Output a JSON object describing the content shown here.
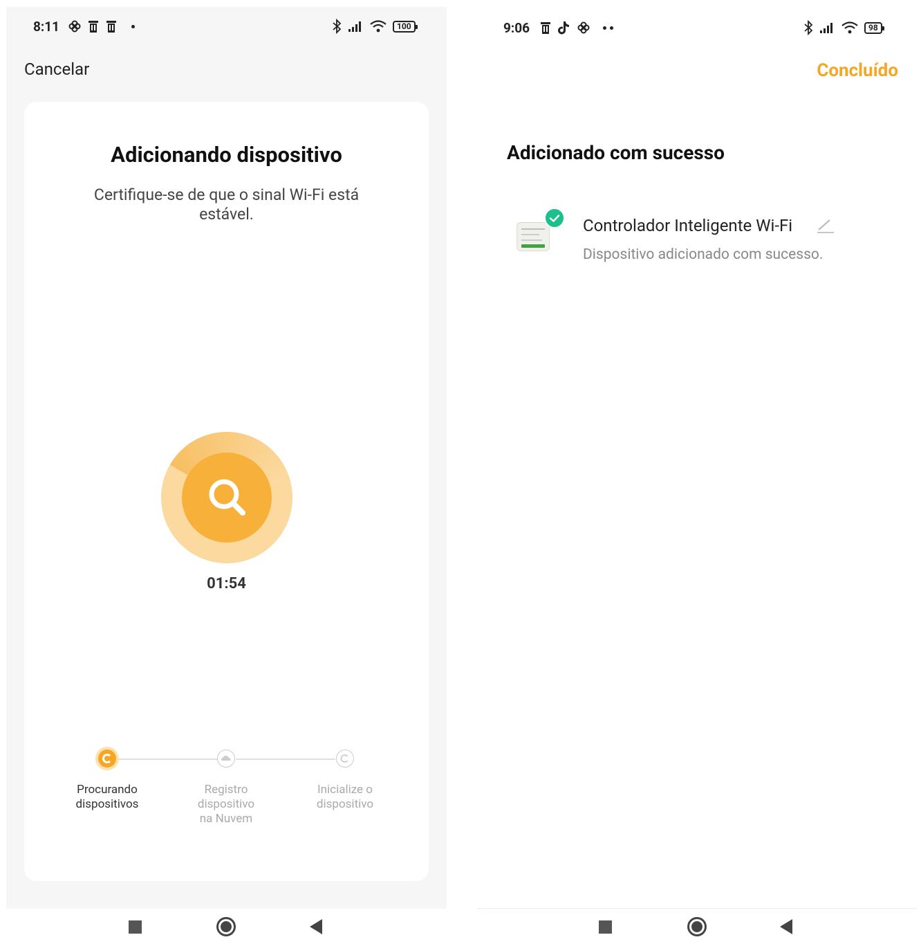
{
  "left": {
    "status": {
      "time": "8:11",
      "battery": "100"
    },
    "cancel_label": "Cancelar",
    "title": "Adicionando dispositivo",
    "subtitle": "Certifique-se de que o sinal Wi-Fi está estável.",
    "timer": "01:54",
    "steps": [
      {
        "label": "Procurando dispositivos",
        "active": true
      },
      {
        "label": "Registro dispositivo na Nuvem",
        "active": false
      },
      {
        "label": "Inicialize o dispositivo",
        "active": false
      }
    ]
  },
  "right": {
    "status": {
      "time": "9:06",
      "battery": "98"
    },
    "done_label": "Concluído",
    "title": "Adicionado com sucesso",
    "device": {
      "name": "Controlador Inteligente Wi-Fi",
      "status": "Dispositivo adicionado com sucesso."
    }
  },
  "colors": {
    "accent": "#f5a623",
    "success": "#1dbf8a",
    "primary_text": "#111111",
    "muted_text": "#aaaaaa"
  }
}
